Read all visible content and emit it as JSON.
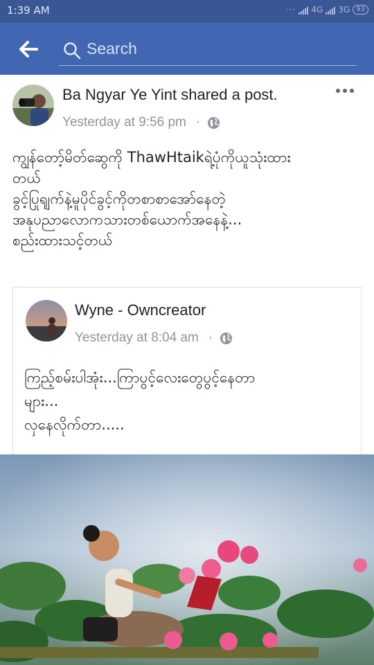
{
  "status_bar": {
    "time": "1:39 AM",
    "network_1": "4G",
    "network_2": "3G",
    "battery": "93"
  },
  "header": {
    "back_icon": "arrow-left-icon",
    "search_icon": "search-icon",
    "search_placeholder": "Search",
    "background": "#4267b2"
  },
  "post": {
    "author_line": "Ba Ngyar Ye Yint shared a post.",
    "timestamp": "Yesterday at 9:56 pm",
    "separator": "·",
    "privacy_icon": "globe-icon",
    "more_icon": "more-horizontal-icon",
    "message_lines": [
      "ကျွန်တော့်မိတ်ဆွေကို ThawHtaikရဲ့ပုံကိုယူသုံးထား",
      "တယ်",
      "ခွင့်ပြုရျက်နဲ့မူပိုင်ခွင့်ကိုတစာစာအော်နေတဲ့",
      "အနုပညာလောကသားတစ်ယောက်အနေနဲ့...",
      "စည်းထားသင့်တယ်"
    ]
  },
  "shared_post": {
    "author": "Wyne - Owncreator",
    "timestamp": "Yesterday at 8:04 am",
    "separator": "·",
    "privacy_icon": "globe-icon",
    "message_lines": [
      "ကြည့်စမ်းပါအုံး...ကြာပွင့်လေးတွေပွင့်နေတာ",
      "များ...",
      "လှနေလိုက်တာ....."
    ]
  }
}
